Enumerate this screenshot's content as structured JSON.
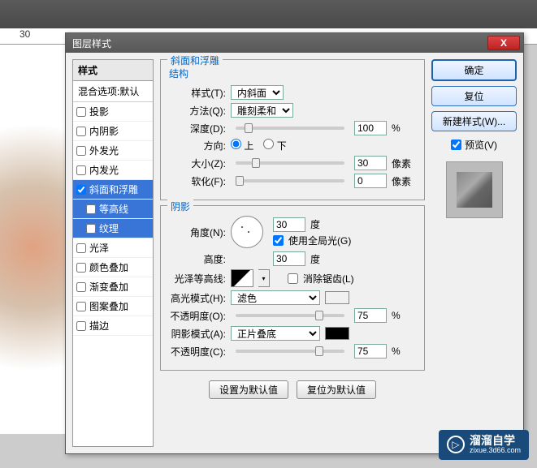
{
  "ruler": {
    "mark": "30"
  },
  "dialog": {
    "title": "图层样式",
    "close": "X"
  },
  "styles": {
    "header": "样式",
    "blend": "混合选项:默认",
    "items": [
      {
        "label": "投影",
        "checked": false
      },
      {
        "label": "内阴影",
        "checked": false
      },
      {
        "label": "外发光",
        "checked": false
      },
      {
        "label": "内发光",
        "checked": false
      },
      {
        "label": "斜面和浮雕",
        "checked": true,
        "selected": true
      },
      {
        "label": "等高线",
        "checked": false,
        "child": true,
        "selected": true
      },
      {
        "label": "纹理",
        "checked": false,
        "child": true,
        "selected": true
      },
      {
        "label": "光泽",
        "checked": false
      },
      {
        "label": "颜色叠加",
        "checked": false
      },
      {
        "label": "渐变叠加",
        "checked": false
      },
      {
        "label": "图案叠加",
        "checked": false
      },
      {
        "label": "描边",
        "checked": false
      }
    ]
  },
  "bevel": {
    "group_title": "斜面和浮雕",
    "structure": "结构",
    "style_label": "样式(T):",
    "style_value": "内斜面",
    "technique_label": "方法(Q):",
    "technique_value": "雕刻柔和",
    "depth_label": "深度(D):",
    "depth_value": "100",
    "depth_unit": "%",
    "direction_label": "方向:",
    "up": "上",
    "down": "下",
    "size_label": "大小(Z):",
    "size_value": "30",
    "size_unit": "像素",
    "soften_label": "软化(F):",
    "soften_value": "0",
    "soften_unit": "像素"
  },
  "shading": {
    "title": "阴影",
    "angle_label": "角度(N):",
    "angle_value": "30",
    "angle_unit": "度",
    "global_light": "使用全局光(G)",
    "altitude_label": "高度:",
    "altitude_value": "30",
    "altitude_unit": "度",
    "gloss_label": "光泽等高线:",
    "antialias": "消除锯齿(L)",
    "highlight_mode_label": "高光模式(H):",
    "highlight_mode_value": "滤色",
    "highlight_color": "#ffffff",
    "highlight_opacity_label": "不透明度(O):",
    "highlight_opacity_value": "75",
    "highlight_opacity_unit": "%",
    "shadow_mode_label": "阴影模式(A):",
    "shadow_mode_value": "正片叠底",
    "shadow_color": "#000000",
    "shadow_opacity_label": "不透明度(C):",
    "shadow_opacity_value": "75",
    "shadow_opacity_unit": "%"
  },
  "defaults": {
    "make": "设置为默认值",
    "reset": "复位为默认值"
  },
  "right": {
    "ok": "确定",
    "cancel": "复位",
    "new_style": "新建样式(W)...",
    "preview": "预览(V)"
  },
  "watermark": {
    "name": "溜溜自学",
    "url": "zixue.3d66.com"
  }
}
